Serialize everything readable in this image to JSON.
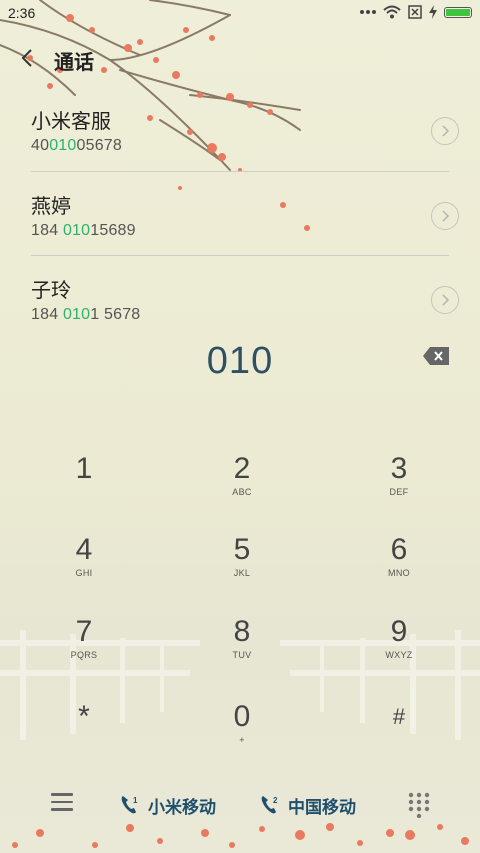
{
  "status_bar": {
    "time": "2:36"
  },
  "header": {
    "title": "通话"
  },
  "contacts": [
    {
      "name": "小米客服",
      "number_pre": "40",
      "number_match": "010",
      "number_post": "05678"
    },
    {
      "name": "燕婷",
      "number_pre": "184 ",
      "number_match": "010",
      "number_post": "15689"
    },
    {
      "name": "子玲",
      "number_pre": "184 ",
      "number_match": "010",
      "number_post": "1 5678"
    }
  ],
  "dial_input": "010",
  "keypad": [
    {
      "digit": "1",
      "letters": ""
    },
    {
      "digit": "2",
      "letters": "ABC"
    },
    {
      "digit": "3",
      "letters": "DEF"
    },
    {
      "digit": "4",
      "letters": "GHI"
    },
    {
      "digit": "5",
      "letters": "JKL"
    },
    {
      "digit": "6",
      "letters": "MNO"
    },
    {
      "digit": "7",
      "letters": "PQRS"
    },
    {
      "digit": "8",
      "letters": "TUV"
    },
    {
      "digit": "9",
      "letters": "WXYZ"
    },
    {
      "digit": "*",
      "letters": ""
    },
    {
      "digit": "0",
      "letters": "+"
    },
    {
      "digit": "#",
      "letters": ""
    }
  ],
  "bottom_bar": {
    "sim1_label": "小米移动",
    "sim1_badge": "1",
    "sim2_label": "中国移动",
    "sim2_badge": "2"
  },
  "colors": {
    "accent_match": "#2cb36a",
    "dial_text": "#2f4f62",
    "sim_text": "#1f4f6c",
    "battery": "#3fc43f"
  }
}
